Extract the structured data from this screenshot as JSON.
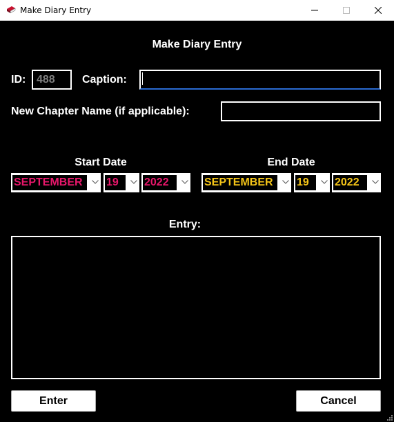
{
  "window": {
    "title": "Make Diary Entry"
  },
  "form": {
    "heading": "Make Diary Entry",
    "id_label": "ID:",
    "id_value": "488",
    "caption_label": "Caption:",
    "caption_value": "",
    "chapter_label": "New Chapter Name (if applicable):",
    "chapter_value": "",
    "start_date": {
      "label": "Start Date",
      "month": "SEPTEMBER",
      "day": "19",
      "year": "2022",
      "text_color": "#e8176b"
    },
    "end_date": {
      "label": "End Date",
      "month": "SEPTEMBER",
      "day": "19",
      "year": "2022",
      "text_color": "#f5c518"
    },
    "entry_label": "Entry:",
    "entry_value": ""
  },
  "buttons": {
    "enter": "Enter",
    "cancel": "Cancel"
  },
  "icons": {
    "app": "book-icon",
    "minimize": "minimize-icon",
    "maximize": "maximize-icon",
    "close": "close-icon",
    "dropdown": "chevron-down-icon",
    "resize": "resize-grip-icon"
  }
}
